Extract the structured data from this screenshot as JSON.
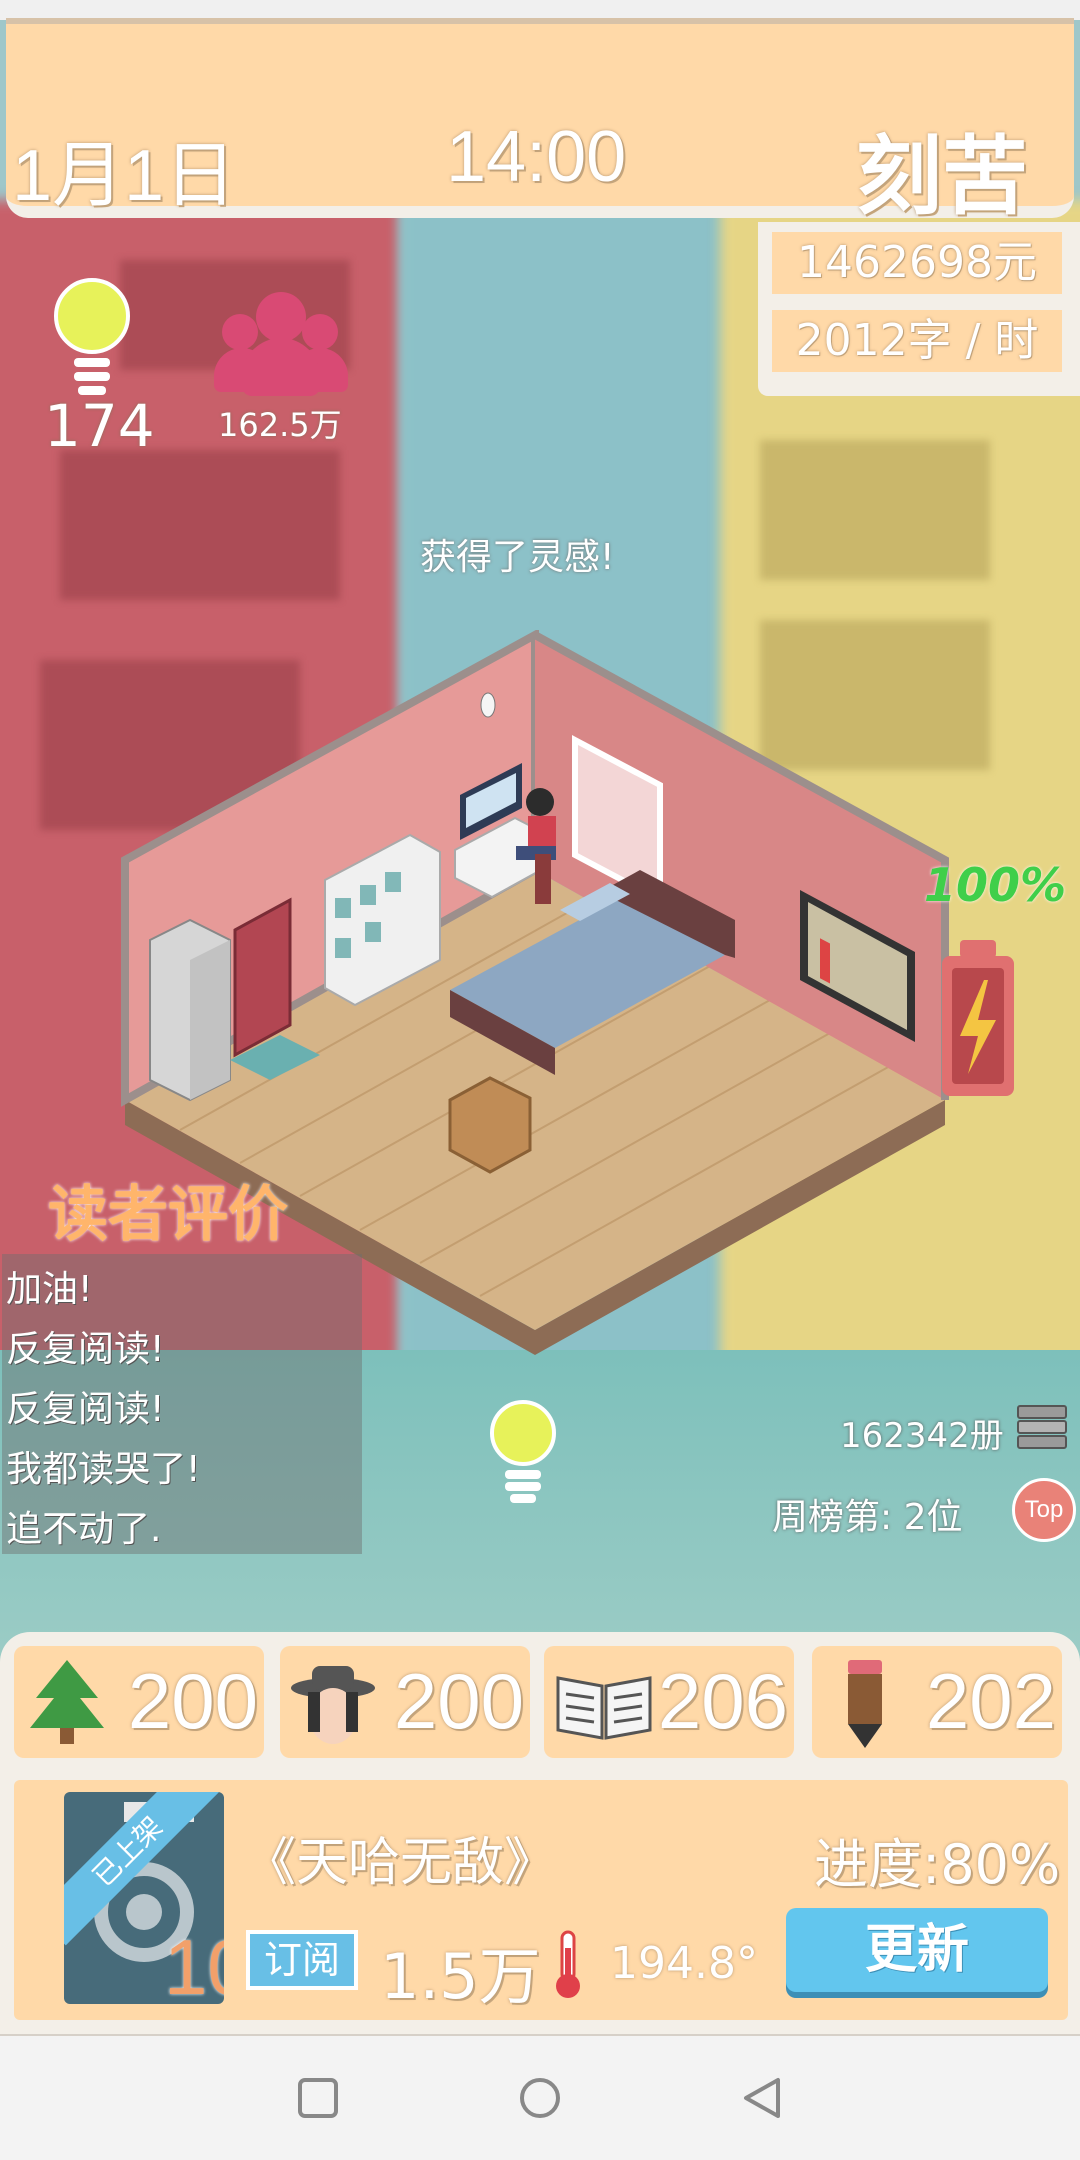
{
  "header": {
    "date": "1月1日",
    "time": "14:00",
    "mode": "刻苦"
  },
  "stats": {
    "money": "1462698元",
    "speed": "2012字 / 时"
  },
  "status": {
    "inspiration": "174",
    "fans": "162.5万",
    "message": "获得了灵感!",
    "battery": "100%"
  },
  "reviews": {
    "title": "读者评价",
    "lines": [
      "加油!",
      "反复阅读!",
      "反复阅读!",
      "我都读哭了!",
      "追不动了."
    ]
  },
  "sales": {
    "copies": "162342册",
    "rank": "周榜第: 2位",
    "top_label": "Top"
  },
  "resources": [
    {
      "icon": "tree-icon",
      "value": "200"
    },
    {
      "icon": "hat-character-icon",
      "value": "200"
    },
    {
      "icon": "open-book-icon",
      "value": "206"
    },
    {
      "icon": "pencil-icon",
      "value": "202"
    }
  ],
  "book": {
    "ribbon": "已上架",
    "level": "10",
    "title": "《天哈无敌》",
    "progress": "进度:80%",
    "subscribe_label": "订阅",
    "subscribers": "1.5万",
    "heat": "194.8°",
    "update_label": "更新"
  },
  "colors": {
    "panel": "#ffd9a8",
    "accent_blue": "#62c6ee",
    "fans_pink": "#d94a74",
    "battery_green": "#3fcf4a"
  }
}
